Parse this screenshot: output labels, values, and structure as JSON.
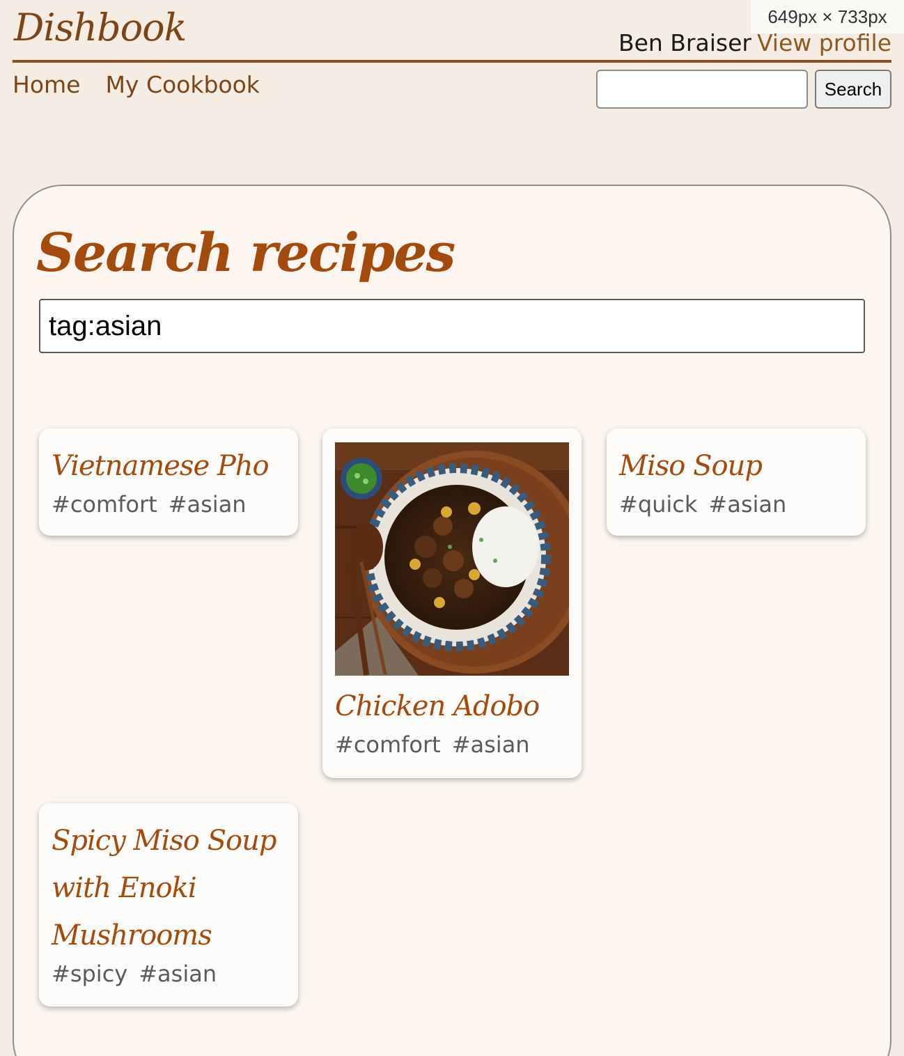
{
  "overlay": {
    "size_label": "649px × 733px"
  },
  "header": {
    "logo": "Dishbook",
    "user_name": "Ben Braiser",
    "profile_link": "View profile"
  },
  "nav": {
    "home": "Home",
    "cookbook": "My Cookbook"
  },
  "top_search": {
    "value": "",
    "button": "Search"
  },
  "main": {
    "title": "Search recipes",
    "search_value": "tag:asian"
  },
  "recipes": [
    {
      "title": "Vietnamese Pho",
      "tags": [
        "#comfort",
        "#asian"
      ]
    },
    {
      "title": "Chicken Adobo",
      "tags": [
        "#comfort",
        "#asian"
      ],
      "image": "chicken-adobo-photo"
    },
    {
      "title": "Miso Soup",
      "tags": [
        "#quick",
        "#asian"
      ]
    },
    {
      "title": "Spicy Miso Soup with Enoki Mushrooms",
      "tags": [
        "#spicy",
        "#asian"
      ]
    }
  ],
  "colors": {
    "background": "#f5ede3",
    "panel": "#fdf6f0",
    "accent": "#a34b0e",
    "brand": "#7a4519",
    "tag_text": "#5b5b5b"
  }
}
